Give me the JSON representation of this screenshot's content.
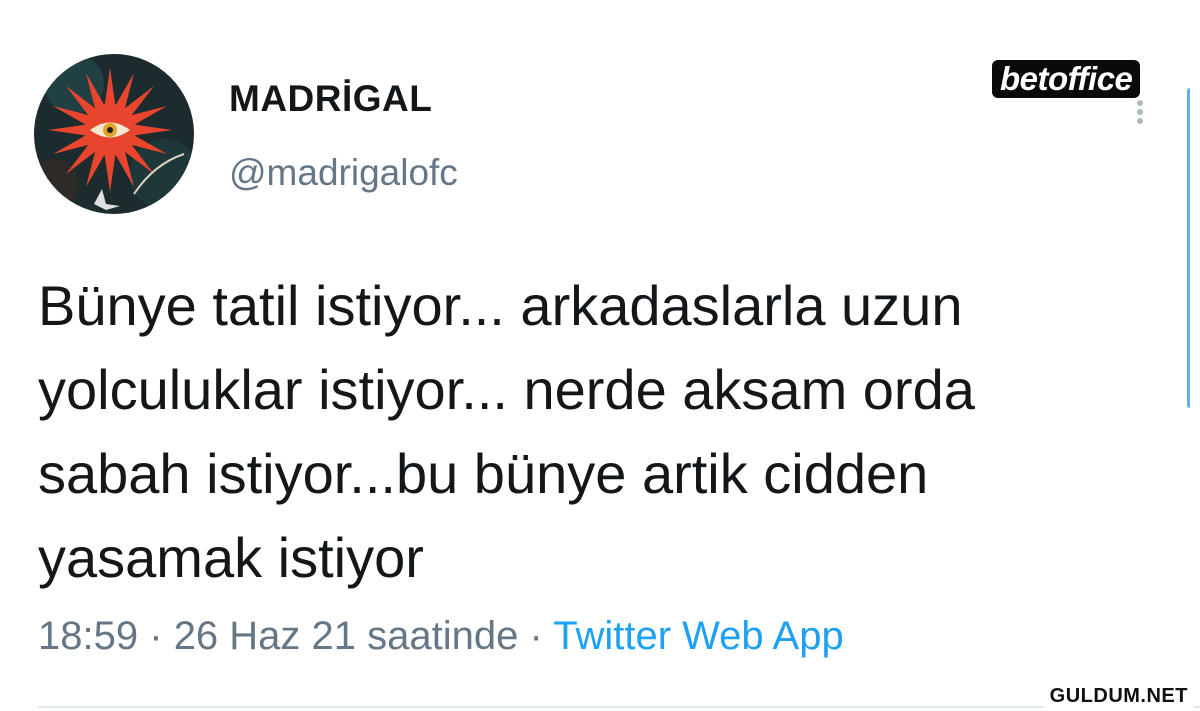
{
  "tweet": {
    "author": {
      "display_name": "MADRİGAL",
      "handle": "@madrigalofc",
      "avatar_icon": "sun-eye-avatar"
    },
    "text": "Bünye tatil istiyor... arkadaslarla uzun\nyolculuklar istiyor... nerde aksam orda\nsabah istiyor...bu bünye artik cidden\nyasamak istiyor",
    "time": "18:59",
    "separator": "·",
    "date": "26 Haz 21 saatinde",
    "source": "Twitter Web App"
  },
  "watermarks": {
    "top": "betoffice",
    "bottom": "GULDUM.NET"
  },
  "colors": {
    "text": "#14171a",
    "secondary": "#657786",
    "link": "#1da1f2",
    "accent": "#5ab2e8"
  },
  "icons": {
    "more": "more-dots-icon"
  }
}
